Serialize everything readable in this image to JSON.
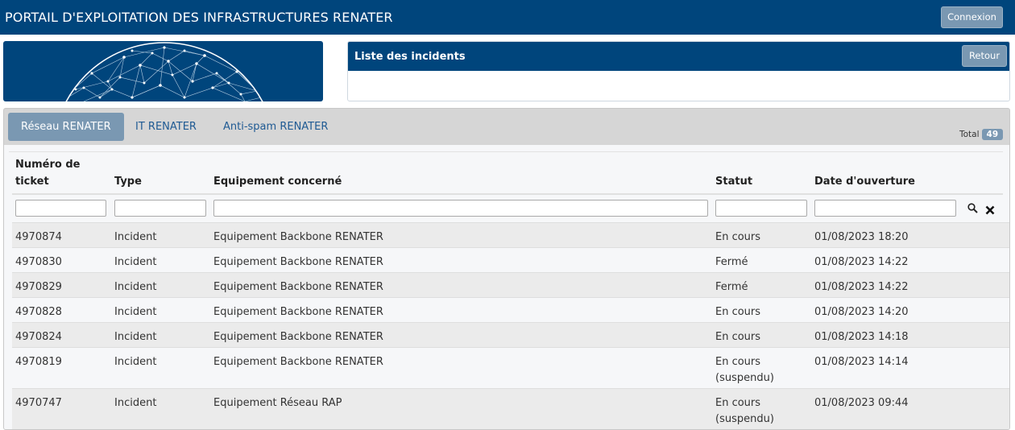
{
  "header": {
    "title": "PORTAIL D'EXPLOITATION DES INFRASTRUCTURES RENATER",
    "login_label": "Connexion"
  },
  "panel": {
    "title": "Liste des incidents",
    "back_label": "Retour"
  },
  "tabs": [
    {
      "label": "Réseau RENATER",
      "active": true
    },
    {
      "label": "IT RENATER",
      "active": false
    },
    {
      "label": "Anti-spam RENATER",
      "active": false
    }
  ],
  "total": {
    "label": "Total",
    "count": "49"
  },
  "table": {
    "columns": {
      "ticket_line1": "Numéro de",
      "ticket_line2": "ticket",
      "type": "Type",
      "equipment": "Equipement concerné",
      "status": "Statut",
      "opened": "Date d'ouverture"
    },
    "rows": [
      {
        "ticket": "4970874",
        "type": "Incident",
        "equipment": "Equipement Backbone RENATER",
        "status": "En cours",
        "status2": "",
        "opened": "01/08/2023 18:20"
      },
      {
        "ticket": "4970830",
        "type": "Incident",
        "equipment": "Equipement Backbone RENATER",
        "status": "Fermé",
        "status2": "",
        "opened": "01/08/2023 14:22"
      },
      {
        "ticket": "4970829",
        "type": "Incident",
        "equipment": "Equipement Backbone RENATER",
        "status": "Fermé",
        "status2": "",
        "opened": "01/08/2023 14:22"
      },
      {
        "ticket": "4970828",
        "type": "Incident",
        "equipment": "Equipement Backbone RENATER",
        "status": "En cours",
        "status2": "",
        "opened": "01/08/2023 14:20"
      },
      {
        "ticket": "4970824",
        "type": "Incident",
        "equipment": "Equipement Backbone RENATER",
        "status": "En cours",
        "status2": "",
        "opened": "01/08/2023 14:18"
      },
      {
        "ticket": "4970819",
        "type": "Incident",
        "equipment": "Equipement Backbone RENATER",
        "status": "En cours",
        "status2": "(suspendu)",
        "opened": "01/08/2023 14:14"
      },
      {
        "ticket": "4970747",
        "type": "Incident",
        "equipment": "Equipement Réseau RAP",
        "status": "En cours",
        "status2": "(suspendu)",
        "opened": "01/08/2023 09:44"
      }
    ]
  },
  "icons": {
    "search": "search-icon",
    "clear": "close-icon"
  },
  "colors": {
    "brand": "#00457c",
    "button": "#7a98b2",
    "link": "#1f5a93"
  }
}
